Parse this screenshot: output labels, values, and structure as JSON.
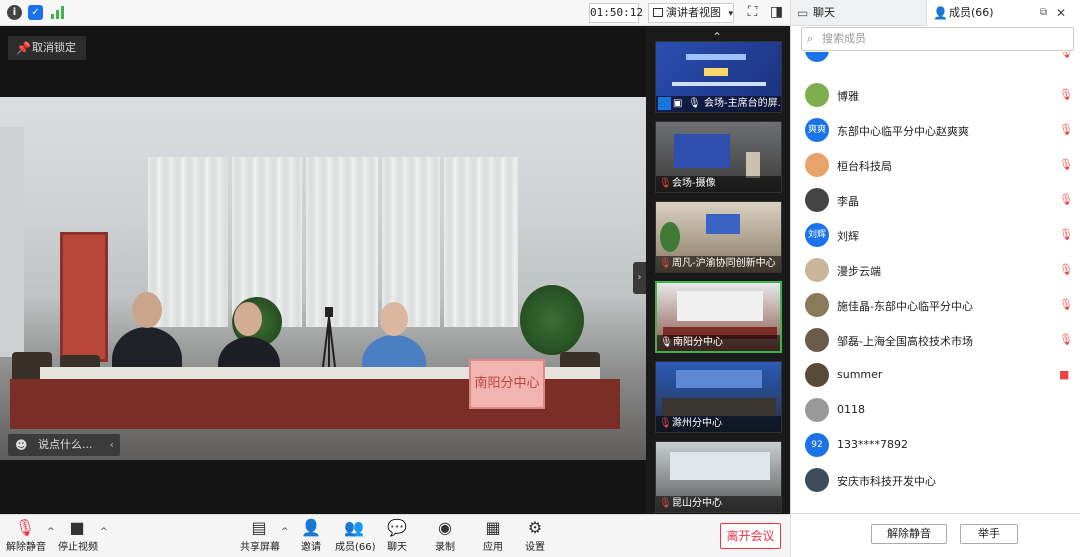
{
  "topbar": {
    "timer": "01:50:12",
    "view_label": "演讲者视图",
    "view_caret": "▾"
  },
  "main": {
    "unpin_label": "取消锁定",
    "nameplate": "南阳分中心",
    "comment_placeholder": "说点什么..."
  },
  "thumbnails": [
    {
      "label": "会场-主席台的屏..."
    },
    {
      "label": "会场-摄像"
    },
    {
      "label": "周凡-沪渝协同创新中心"
    },
    {
      "label": "南阳分中心"
    },
    {
      "label": "滁州分中心"
    },
    {
      "label": "昆山分中心"
    }
  ],
  "toolbar": {
    "unmute": "解除静音",
    "stop_video": "停止视频",
    "share_screen": "共享屏幕",
    "invite": "邀请",
    "members": "成员(66)",
    "chat": "聊天",
    "record": "录制",
    "apps": "应用",
    "settings": "设置",
    "leave": "离开会议"
  },
  "panel": {
    "tab_chat": "聊天",
    "tab_members": "成员(66)",
    "search_placeholder": "搜索成员",
    "members": [
      {
        "name": "博雅",
        "avatar": "",
        "color": "#7fae4e"
      },
      {
        "name": "东部中心临平分中心赵爽爽",
        "avatar": "爽爽",
        "color": "#1a73e8"
      },
      {
        "name": "桓台科技局",
        "avatar": "",
        "color": "#e8a36a"
      },
      {
        "name": "李晶",
        "avatar": "",
        "color": "#444"
      },
      {
        "name": "刘辉",
        "avatar": "刘辉",
        "color": "#1a73e8"
      },
      {
        "name": "漫步云端",
        "avatar": "",
        "color": "#c9b69a"
      },
      {
        "name": "施佳晶-东部中心临平分中心",
        "avatar": "",
        "color": "#8a7a5a"
      },
      {
        "name": "邹磊-上海全国高校技术市场",
        "avatar": "",
        "color": "#6a5b4b"
      },
      {
        "name": "summer",
        "avatar": "",
        "color": "#5a4a3a"
      },
      {
        "name": "0118",
        "avatar": "",
        "color": "#999"
      },
      {
        "name": "133****7892",
        "avatar": "92",
        "color": "#1a73e8"
      },
      {
        "name": "安庆市科技开发中心",
        "avatar": "",
        "color": "#3c4a5a"
      }
    ],
    "unmute_all": "解除静音",
    "raise_hand": "举手"
  },
  "colors": {
    "accent": "#1a73e8",
    "danger": "#e34",
    "active_border": "#3cb44b"
  }
}
